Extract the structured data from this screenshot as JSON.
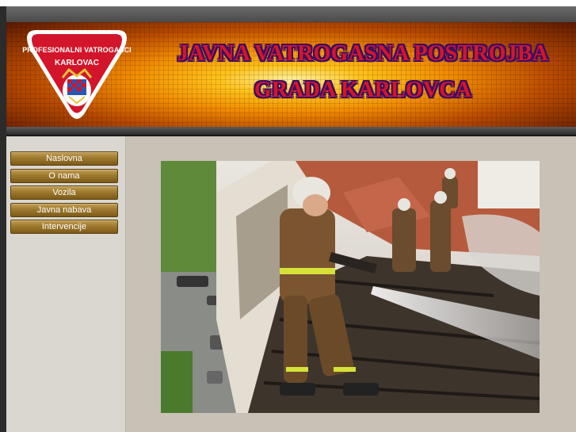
{
  "header": {
    "emblem_top_text": "PROFESIONALNI VATROGASCI",
    "emblem_city_text": "KARLOVAC",
    "title_line1": "JAVNA VATROGASNA POSTROJBA",
    "title_line2": "GRADA KARLOVCA"
  },
  "nav": {
    "items": [
      {
        "label": "Naslovna"
      },
      {
        "label": "O nama"
      },
      {
        "label": "Vozila"
      },
      {
        "label": "Javna nabava"
      },
      {
        "label": "Intervencije"
      }
    ]
  },
  "colors": {
    "title_red": "#d3162a",
    "title_outline": "#3a0d63",
    "nav_gold": "#9e7a2e",
    "sidebar_bg": "#d9d7d0",
    "content_bg": "#c8c1b6"
  }
}
